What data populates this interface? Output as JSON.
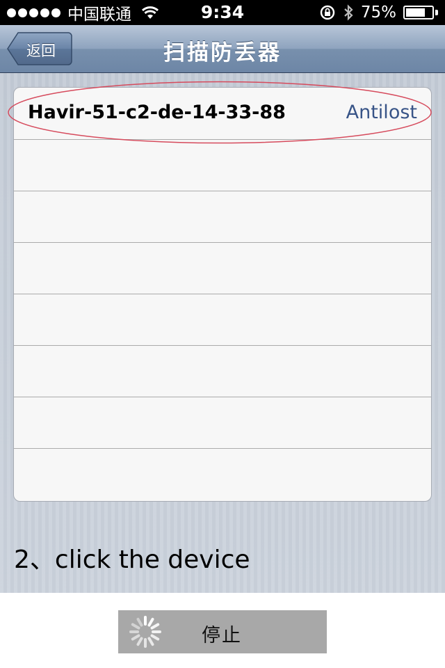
{
  "status_bar": {
    "carrier": "中国联通",
    "time": "9:34",
    "battery_percent": "75%",
    "battery_level": 0.75
  },
  "nav": {
    "back_label": "返回",
    "title": "扫描防丢器"
  },
  "devices": [
    {
      "name": "Havir-51-c2-de-14-33-88",
      "type": "Antilost"
    }
  ],
  "instruction": "2、click the device",
  "stop_button": {
    "label": "停止"
  },
  "colors": {
    "highlight": "#d64a5c",
    "device_type": "#385487"
  }
}
